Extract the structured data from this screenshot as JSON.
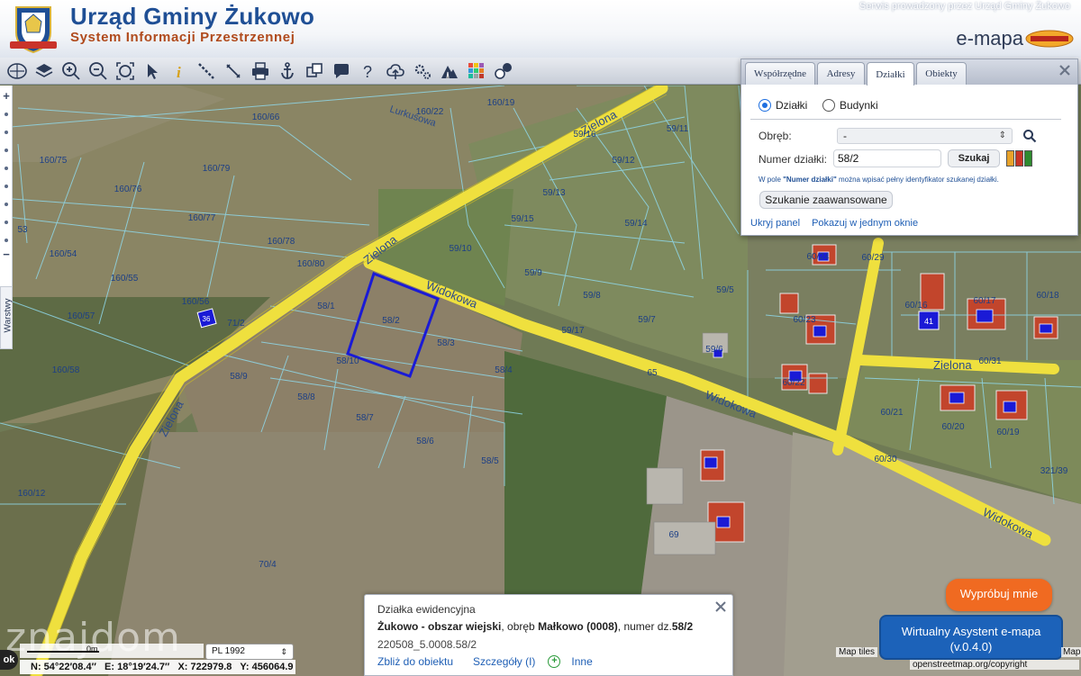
{
  "header": {
    "title": "Urząd Gminy Żukowo",
    "subtitle": "System Informacji Przestrzennej",
    "served_by": "Serwis prowadzony przez Urząd Gminy Żukowo",
    "product": "e-mapa",
    "colors": {
      "title": "#1f4f95",
      "subtitle": "#b04a1c"
    }
  },
  "toolbar": {
    "icons": [
      "overview-map-icon",
      "layers-icon",
      "zoom-in-icon",
      "zoom-out-icon",
      "zoom-extent-icon",
      "select-arrow-icon",
      "info-icon",
      "measure-distance-icon",
      "measure-area-icon",
      "print-icon",
      "anchor-icon",
      "copy-coordinates-icon",
      "comment-icon",
      "help-icon",
      "upload-icon",
      "settings-icon",
      "terrain-icon",
      "legend-icon",
      "message-icon"
    ]
  },
  "sidebar": {
    "layers_label": "Warstwy"
  },
  "panel": {
    "tabs": [
      {
        "label": "Współrzędne",
        "active": false
      },
      {
        "label": "Adresy",
        "active": false
      },
      {
        "label": "Działki",
        "active": true
      },
      {
        "label": "Obiekty",
        "active": false
      }
    ],
    "radio_dzialki": "Działki",
    "radio_budynki": "Budynki",
    "obreb_label": "Obręb:",
    "obreb_value": "-",
    "numer_label": "Numer działki:",
    "numer_value": "58/2",
    "search_button": "Szukaj",
    "hint_prefix": "W pole",
    "hint_field": "\"Numer działki\"",
    "hint_rest": "można wpisać pełny identyfikator szukanej działki.",
    "advanced_button": "Szukanie zaawansowane",
    "hide_panel": "Ukryj panel",
    "show_in_window": "Pokazuj w jednym oknie"
  },
  "map": {
    "roads": {
      "zielona_top": "Zielona",
      "zielona_mid": "Zielona",
      "zielona_left": "Zielona",
      "zielona_right": "Zielona",
      "widokowa_1": "Widokowa",
      "widokowa_2": "Widokowa",
      "widokowa_3": "Widokowa",
      "lurkusowa": "Lurkusowa"
    },
    "parcels": [
      "160/66",
      "160/22",
      "160/19",
      "160/75",
      "160/79",
      "160/76",
      "160/77",
      "53",
      "160/54",
      "160/78",
      "160/80",
      "160/55",
      "160/56",
      "160/57",
      "71/2",
      "58/1",
      "58/2",
      "58/3",
      "58/10",
      "58/9",
      "58/8",
      "58/7",
      "58/4",
      "58/6",
      "58/5",
      "59/16",
      "59/11",
      "59/12",
      "59/13",
      "59/15",
      "59/14",
      "59/10",
      "59/9",
      "59/8",
      "59/5",
      "59/17",
      "59/7",
      "59/6",
      "65",
      "160/58",
      "160/12",
      "70/4",
      "69",
      "60/24",
      "60/29",
      "60/23",
      "60/22",
      "60/16",
      "60/17",
      "60/18",
      "60/31",
      "60/21",
      "60/20",
      "60/19",
      "60/30",
      "321/39"
    ],
    "badges": [
      "36",
      "41"
    ],
    "highlighted_parcel": "58/2",
    "highlight_color": "#1a1ad6",
    "road_color": "#f0e040"
  },
  "info": {
    "title": "Działka ewidencyjna",
    "place": "Żukowo - obszar wiejski",
    "obreb_text": ", obręb ",
    "obreb_name": "Małkowo (0008)",
    "numer_text": ", numer dz.",
    "numer": "58/2",
    "identifier": "220508_5.0008.58/2",
    "zoom_link": "Zbliż do obiektu",
    "details_link": "Szczegóły (I)",
    "other_link": "Inne"
  },
  "assistant": {
    "try_label": "Wypróbuj mnie",
    "line1": "Wirtualny Asystent e-mapa",
    "line2": "(v.0.4.0)",
    "try_color": "#f06a21",
    "button_color": "#1c62b9"
  },
  "status": {
    "ok": "ok",
    "scale_text": "0m",
    "crs": "PL 1992",
    "n": "N: 54°22′08.4″",
    "e": "E: 18°19′24.7″",
    "x": "X: 722979.8",
    "y": "Y: 456064.9",
    "attr_tiles": "Map tiles",
    "attr_osm": "openstreetmap.org/copyright",
    "attr_map": "Map",
    "watermark": "znajdom"
  }
}
